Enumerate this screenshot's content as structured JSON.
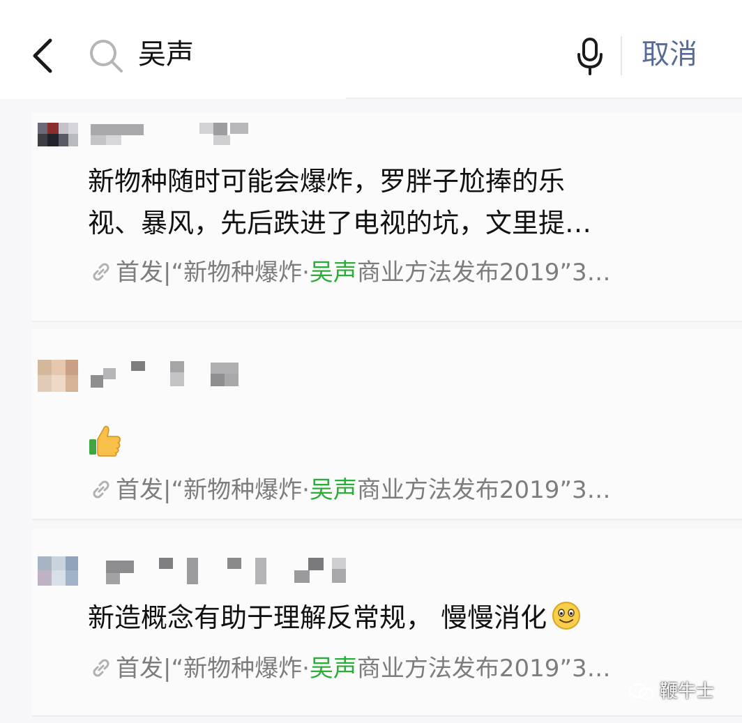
{
  "header": {
    "back_icon": "chevron-left-icon",
    "search_icon": "search-icon",
    "search_query": "吴声",
    "mic_icon": "microphone-icon",
    "cancel_label": "取消"
  },
  "results": [
    {
      "author_blurred": true,
      "text_line1": "新物种随时可能会爆炸，罗胖子尬捧的乐",
      "text_line2": "视、暴风，先后跌进了电视的坑，文里提…",
      "source_prefix": "首发|“新物种爆炸·",
      "source_highlight": "吴声",
      "source_suffix": "商业方法发布2019”3…"
    },
    {
      "author_blurred": true,
      "emoji": "thumbs-up-emoji",
      "source_prefix": "首发|“新物种爆炸·",
      "source_highlight": "吴声",
      "source_suffix": "商业方法发布2019”3…"
    },
    {
      "author_blurred": true,
      "text": "新造概念有助于理解反常规， 慢慢消化",
      "emoji": "smiling-face-emoji",
      "source_prefix": "首发|“新物种爆炸·",
      "source_highlight": "吴声",
      "source_suffix": "商业方法发布2019”3…"
    }
  ],
  "watermark": {
    "icon": "wechat-icon",
    "text": "鞭牛士"
  },
  "colors": {
    "cancel": "#576b95",
    "highlight": "#2aae38",
    "source_text": "#7d7d7d",
    "list_bg": "#f7f7f9"
  }
}
